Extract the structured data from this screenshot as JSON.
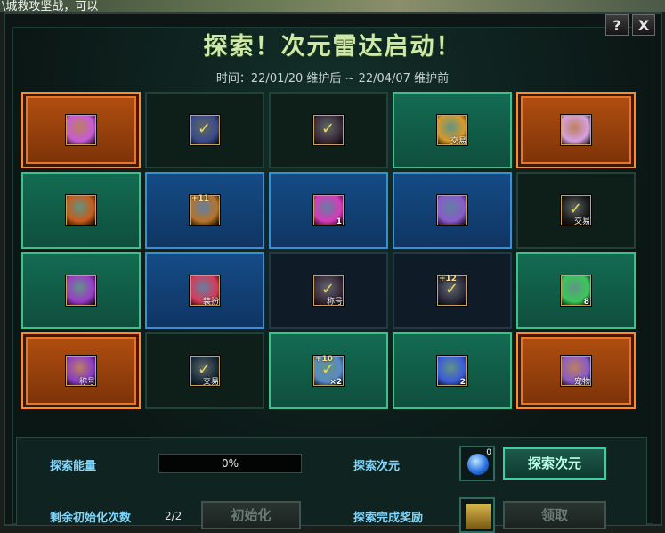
{
  "top_bar": {
    "text": "\\城救攻坚战，可以"
  },
  "window": {
    "help_label": "?",
    "close_label": "X",
    "title": "探索！次元雷达启动！",
    "subtitle": "时间：22/01/20 维护后 ~ 22/04/07 维护前"
  },
  "grid": {
    "rows": [
      [
        {
          "style": "orange",
          "icon": "purple-gem-card-icon",
          "icon_color": "#c85ad8",
          "tag": "",
          "num": "",
          "tl": ""
        },
        {
          "style": "dark",
          "icon": "check-equip-icon",
          "icon_color": "#3a4a8a",
          "tag": "",
          "num": "",
          "tl": ""
        },
        {
          "style": "dark",
          "icon": "check-equip-icon",
          "icon_color": "#3a2a3a",
          "tag": "",
          "num": "",
          "tl": ""
        },
        {
          "style": "green",
          "icon": "gold-contract-icon",
          "icon_color": "#d89a2a",
          "tag": "交易",
          "num": "",
          "tl": ""
        },
        {
          "style": "orange",
          "icon": "purple-gem-card-icon",
          "icon_color": "#d8a0e0",
          "tag": "",
          "num": "",
          "tl": ""
        }
      ],
      [
        {
          "style": "green",
          "icon": "fire-scroll-icon",
          "icon_color": "#c85a1a",
          "tag": "",
          "num": "",
          "tl": ""
        },
        {
          "style": "blue",
          "icon": "upgrade-box-icon",
          "icon_color": "#b8742a",
          "tag": "",
          "num": "",
          "tl": "+11"
        },
        {
          "style": "blue",
          "icon": "pink-costume-icon",
          "icon_color": "#d83ab8",
          "tag": "",
          "num": "1",
          "tl": ""
        },
        {
          "style": "blue",
          "icon": "purple-box-icon",
          "icon_color": "#8a5ac8",
          "tag": "",
          "num": "",
          "tl": ""
        },
        {
          "style": "dark",
          "icon": "check-ticket-icon",
          "icon_color": "#1a1a1a",
          "tag": "交易",
          "num": "",
          "tl": ""
        }
      ],
      [
        {
          "style": "green",
          "icon": "purple-gem-card-icon",
          "icon_color": "#9a3ac8",
          "tag": "",
          "num": "",
          "tl": ""
        },
        {
          "style": "blue",
          "icon": "red-gift-box-icon",
          "icon_color": "#d83a5a",
          "tag": "装扮",
          "num": "",
          "tl": ""
        },
        {
          "style": "navy",
          "icon": "check-equip-icon",
          "icon_color": "#3a2a3a",
          "tag": "称号",
          "num": "",
          "tl": ""
        },
        {
          "style": "navy",
          "icon": "upgrade-ticket-icon",
          "icon_color": "#2a2a3a",
          "tag": "",
          "num": "",
          "tl": "+12"
        },
        {
          "style": "green",
          "icon": "green-costume-icon",
          "icon_color": "#3ac85a",
          "tag": "",
          "num": "8",
          "tl": ""
        }
      ],
      [
        {
          "style": "orange",
          "icon": "title-badge-icon",
          "icon_color": "#8a3ac8",
          "tag": "称号",
          "num": "",
          "tl": ""
        },
        {
          "style": "dark",
          "icon": "check-ticket-icon",
          "icon_color": "#1a2a3a",
          "tag": "交易",
          "num": "",
          "tl": ""
        },
        {
          "style": "green",
          "icon": "upgrade-ticket-icon",
          "icon_color": "#5a8ac8",
          "tag": "",
          "num": "×2",
          "tl": "+10"
        },
        {
          "style": "green",
          "icon": "blue-chest-icon",
          "icon_color": "#3a5ad8",
          "tag": "",
          "num": "2",
          "tl": ""
        },
        {
          "style": "orange",
          "icon": "pet-egg-icon",
          "icon_color": "#8a5ac8",
          "tag": "宠物",
          "num": "",
          "tl": ""
        }
      ]
    ]
  },
  "bottom": {
    "energy_label": "探索能量",
    "energy_value": "0%",
    "energy_fraction": 0,
    "explore_label": "探索次元",
    "gem_count": "0",
    "explore_button": "探索次元",
    "reset_label": "剩余初始化次数",
    "reset_count": "2/2",
    "reset_button": "初始化",
    "reward_label": "探索完成奖励",
    "claim_button": "领取"
  }
}
